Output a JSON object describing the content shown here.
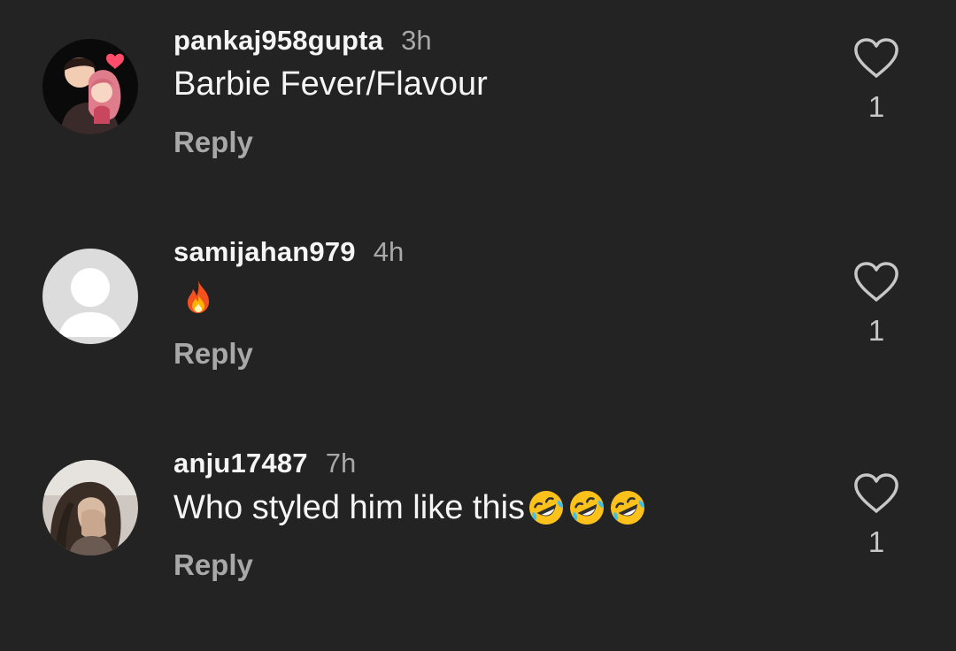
{
  "comments": [
    {
      "username": "pankaj958gupta",
      "time": "3h",
      "text": "Barbie Fever/Flavour",
      "emojis": [],
      "avatar_icon": "cartoon-couple-avatar",
      "reply_label": "Reply",
      "likes": "1"
    },
    {
      "username": "samijahan979",
      "time": "4h",
      "text": "",
      "emojis": [
        "fire"
      ],
      "avatar_icon": "default-user-avatar",
      "reply_label": "Reply",
      "likes": "1"
    },
    {
      "username": "anju17487",
      "time": "7h",
      "text": "Who styled him like this",
      "emojis": [
        "rolling-on-floor-laughing",
        "rolling-on-floor-laughing",
        "rolling-on-floor-laughing"
      ],
      "avatar_icon": "photo-avatar",
      "reply_label": "Reply",
      "likes": "1"
    }
  ],
  "colors": {
    "background": "#232323",
    "username": "#f5f5f5",
    "secondary": "#a8a8a8",
    "heart": "#c7c7c7"
  }
}
